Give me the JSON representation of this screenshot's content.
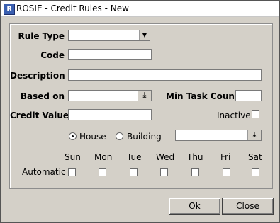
{
  "window": {
    "title": "ROSIE - Credit Rules - New"
  },
  "form": {
    "rule_type_label": "Rule Type",
    "rule_type_value": "",
    "code_label": "Code",
    "code_value": "",
    "description_label": "Description",
    "description_value": "",
    "based_on_label": "Based on",
    "based_on_value": "",
    "min_task_count_label": "Min Task Count",
    "min_task_count_value": "",
    "credit_value_label": "Credit Value",
    "credit_value_value": "",
    "inactive_label": "Inactive",
    "inactive_checked": false,
    "house_label": "House",
    "building_label": "Building",
    "house_selected": true,
    "building_value": "",
    "automatic_label": "Automatic",
    "days": [
      "Sun",
      "Mon",
      "Tue",
      "Wed",
      "Thu",
      "Fri",
      "Sat"
    ]
  },
  "buttons": {
    "ok_label": "Ok",
    "close_label": "Close"
  },
  "icons": {
    "dropdown": "chevron-down-icon",
    "lov": "download-arrow-icon",
    "app": "app-icon"
  }
}
